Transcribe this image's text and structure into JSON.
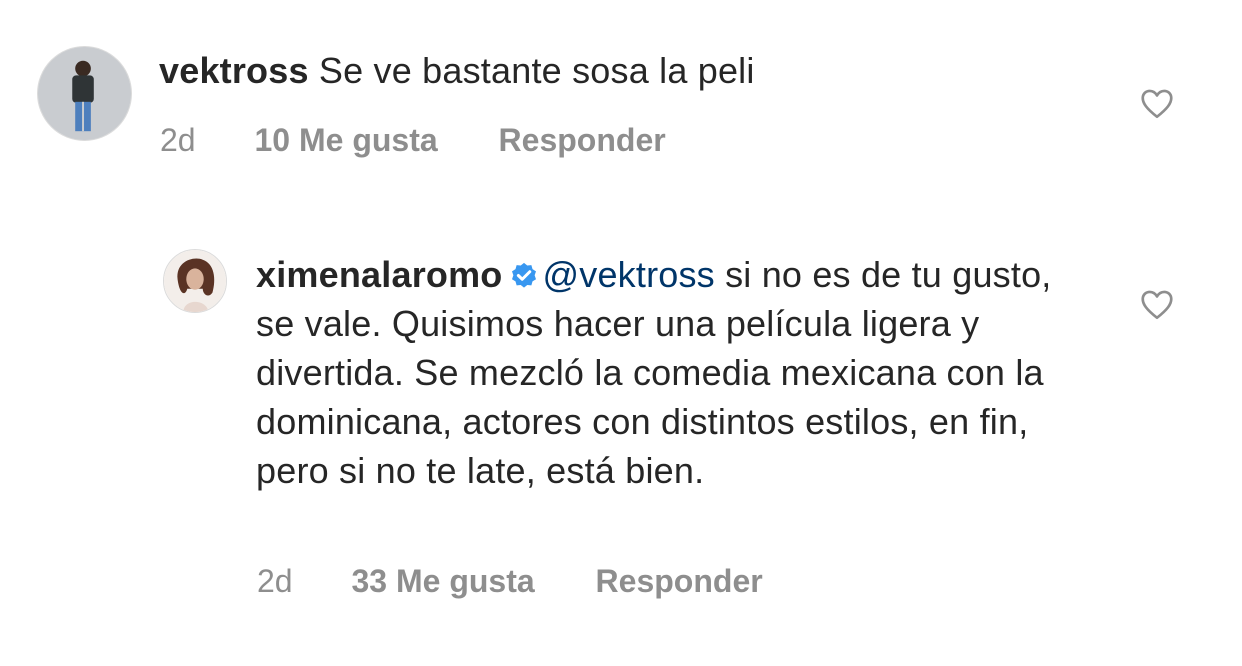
{
  "comments": [
    {
      "username": "vektross",
      "text": "Se ve bastante sosa la peli",
      "time": "2d",
      "likes": "10 Me gusta",
      "reply_label": "Responder",
      "avatar_icon": "user-avatar-man",
      "like_icon": "heart-outline-icon"
    },
    {
      "username": "ximenalaromo",
      "verified_icon": "verified-badge-icon",
      "mention": "@vektross",
      "text": "si no es de tu gusto, se vale. Quisimos hacer una película ligera y divertida. Se mezcló la comedia mexicana con la dominicana, actores con distintos estilos, en fin, pero si no te late, está bien.",
      "time": "2d",
      "likes": "33 Me gusta",
      "reply_label": "Responder",
      "avatar_icon": "user-avatar-woman",
      "like_icon": "heart-outline-icon"
    }
  ],
  "colors": {
    "text": "#262626",
    "meta": "#8e8e8e",
    "mention": "#003569",
    "verified": "#3897f0"
  }
}
